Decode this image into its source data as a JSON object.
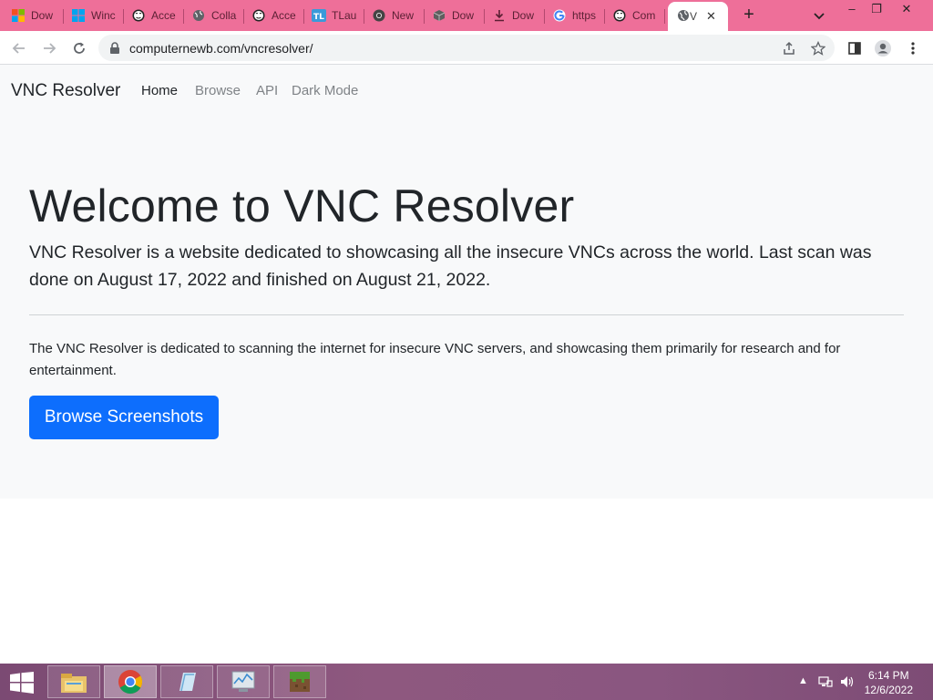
{
  "tabs": [
    {
      "title": "Dow",
      "icon": "microsoft-logo-icon"
    },
    {
      "title": "Winc",
      "icon": "windows-logo-icon"
    },
    {
      "title": "Acce",
      "icon": "hacker-mask-icon"
    },
    {
      "title": "Colla",
      "icon": "globe-icon"
    },
    {
      "title": "Acce",
      "icon": "hacker-mask-icon"
    },
    {
      "title": "TLau",
      "icon": "tlauncher-icon"
    },
    {
      "title": "New",
      "icon": "chrome-icon"
    },
    {
      "title": "Dow",
      "icon": "box-icon"
    },
    {
      "title": "Dow",
      "icon": "download-icon"
    },
    {
      "title": "https",
      "icon": "google-icon"
    },
    {
      "title": "Com",
      "icon": "hacker-mask-icon"
    }
  ],
  "active_tab": {
    "title": "V",
    "icon": "globe-icon",
    "close": "✕"
  },
  "new_tab_label": "+",
  "window_controls": {
    "minimize": "–",
    "restore": "❐",
    "close": "✕"
  },
  "toolbar": {
    "url": "computernewb.com/vncresolver/"
  },
  "site": {
    "brand": "VNC Resolver",
    "nav": [
      {
        "label": "Home",
        "active": true
      },
      {
        "label": "Browse",
        "active": false
      },
      {
        "label": "API",
        "active": false
      },
      {
        "label": "Dark Mode",
        "active": false
      }
    ]
  },
  "hero": {
    "title": "Welcome to VNC Resolver",
    "lead": "VNC Resolver is a website dedicated to showcasing all the insecure VNCs across the world. Last scan was done on August 17, 2022 and finished on August 21, 2022.",
    "body": "The VNC Resolver is dedicated to scanning the internet for insecure VNC servers, and showcasing them primarily for research and for entertainment.",
    "button": "Browse Screenshots"
  },
  "taskbar": {
    "apps": [
      "file-explorer-icon",
      "chrome-icon",
      "notepad-icon",
      "task-manager-icon",
      "minecraft-icon"
    ],
    "active_app": "chrome-icon",
    "time": "6:14 PM",
    "date": "12/6/2022"
  },
  "colors": {
    "tabstrip": "#ee6f99",
    "primary": "#0d6efd",
    "navbar_bg": "#f8f9fa"
  }
}
